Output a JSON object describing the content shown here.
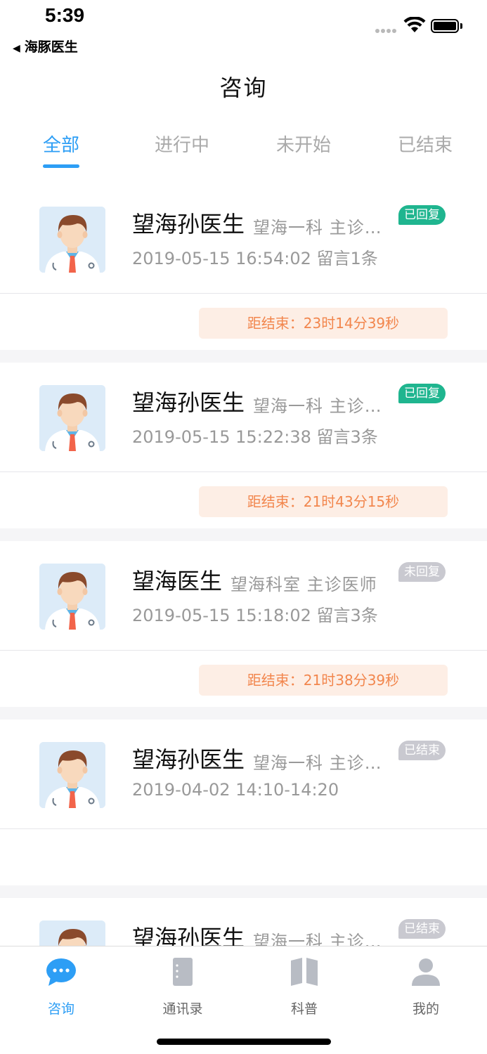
{
  "status": {
    "time": "5:39",
    "back_app": "海豚医生"
  },
  "nav": {
    "title": "咨询"
  },
  "tabs": [
    {
      "label": "全部",
      "active": true
    },
    {
      "label": "进行中",
      "active": false
    },
    {
      "label": "未开始",
      "active": false
    },
    {
      "label": "已结束",
      "active": false
    }
  ],
  "consultations": [
    {
      "doctor": "望海孙医生",
      "dept": "望海一科  主诊…",
      "meta": "2019-05-15 16:54:02 留言1条",
      "badge": "已回复",
      "badge_style": "replied",
      "countdown": "距结束：23时14分39秒"
    },
    {
      "doctor": "望海孙医生",
      "dept": "望海一科  主诊…",
      "meta": "2019-05-15 15:22:38 留言3条",
      "badge": "已回复",
      "badge_style": "replied",
      "countdown": "距结束：21时43分15秒"
    },
    {
      "doctor": "望海医生",
      "dept": "望海科室  主诊医师",
      "meta": "2019-05-15 15:18:02 留言3条",
      "badge": "未回复",
      "badge_style": "grey",
      "countdown": "距结束：21时38分39秒"
    },
    {
      "doctor": "望海孙医生",
      "dept": "望海一科  主诊…",
      "meta": "2019-04-02 14:10-14:20",
      "badge": "已结束",
      "badge_style": "grey",
      "countdown": ""
    },
    {
      "doctor": "望海孙医生",
      "dept": "望海一科  主诊…",
      "meta": "",
      "badge": "已结束",
      "badge_style": "grey",
      "countdown": ""
    }
  ],
  "tabbar": [
    {
      "label": "咨询",
      "icon": "chat-bubble-icon",
      "active": true
    },
    {
      "label": "通讯录",
      "icon": "contacts-book-icon",
      "active": false
    },
    {
      "label": "科普",
      "icon": "open-book-icon",
      "active": false
    },
    {
      "label": "我的",
      "icon": "person-icon",
      "active": false
    }
  ],
  "colors": {
    "accent": "#2d9ef5",
    "replied": "#1fb58f",
    "countdown_text": "#f2864d",
    "countdown_bg": "#fdeee5",
    "muted": "#c9c9d0"
  }
}
